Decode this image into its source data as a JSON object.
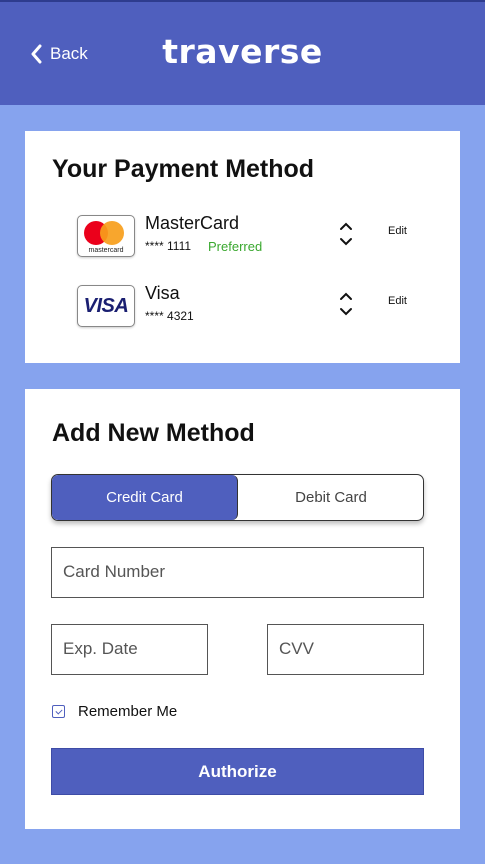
{
  "header": {
    "back_label": "Back",
    "logo_text": "traverse"
  },
  "payment_methods": {
    "title": "Your Payment Method",
    "items": [
      {
        "brand": "MasterCard",
        "logo_text": "mastercard",
        "number": "**** 1111",
        "badge": "Preferred",
        "edit_label": "Edit"
      },
      {
        "brand": "Visa",
        "logo_text": "VISA",
        "number": "**** 4321",
        "badge": "",
        "edit_label": "Edit"
      }
    ]
  },
  "add_method": {
    "title": "Add New Method",
    "tabs": {
      "credit": "Credit Card",
      "debit": "Debit Card",
      "selected": "Credit Card"
    },
    "fields": {
      "card_number_placeholder": "Card Number",
      "exp_date_placeholder": "Exp. Date",
      "cvv_placeholder": "CVV"
    },
    "remember_label": "Remember Me",
    "remember_checked": true,
    "authorize_label": "Authorize"
  },
  "colors": {
    "accent": "#4f5fbe",
    "background": "#86a3ee",
    "preferred": "#3aa82f"
  },
  "icons": {
    "back": "chevron-left-icon",
    "reorder": "chevron-up-down-icon",
    "checkbox": "checkbox-icon"
  }
}
